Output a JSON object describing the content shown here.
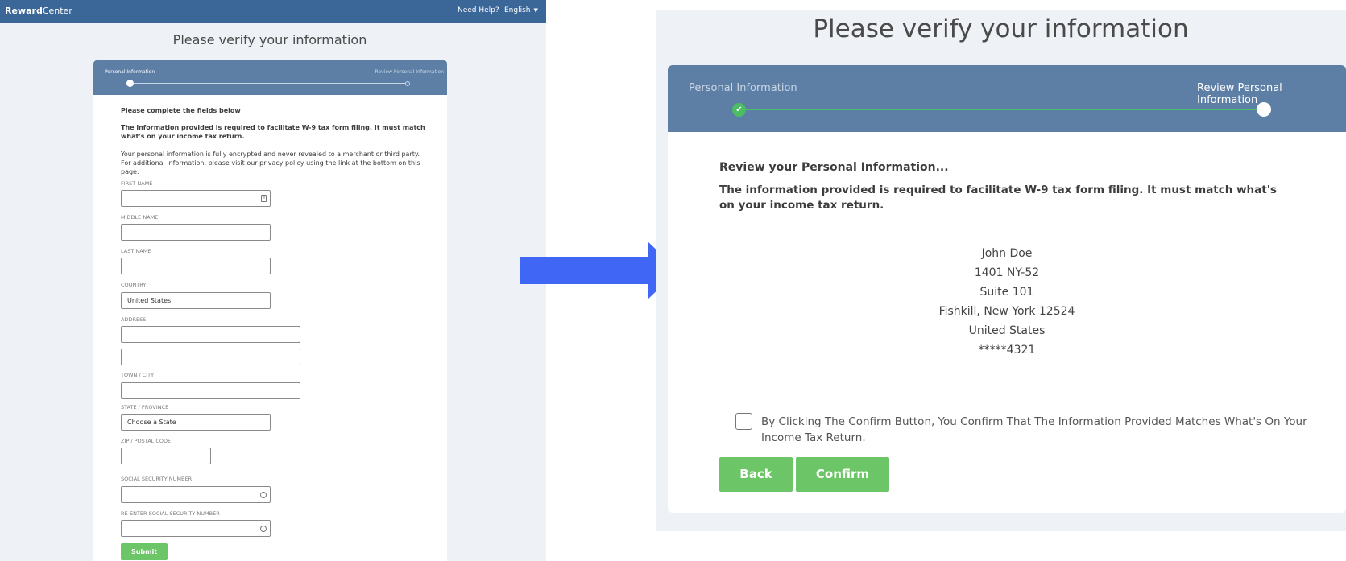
{
  "left": {
    "topbar": {
      "brand_bold": "Reward",
      "brand_thin": "Center",
      "need_help": "Need Help?",
      "language": "English",
      "language_caret": "▼"
    },
    "title": "Please verify your information",
    "progress": {
      "step1": "Personal Information",
      "step2": "Review Personal Information"
    },
    "heading": "Please complete the fields below",
    "notice": "The information provided is required to facilitate W-9 tax form filing. It must match what's on your income tax return.",
    "privacy": "Your personal information is fully encrypted and never revealed to a merchant or third party. For additional information, please visit our privacy policy using the link at the bottom on this page.",
    "fields": {
      "first_name": "FIRST NAME",
      "middle_name": "MIDDLE NAME",
      "last_name": "LAST NAME",
      "country": "COUNTRY",
      "country_value": "United States",
      "address": "ADDRESS",
      "town": "TOWN / CITY",
      "state": "STATE / PROVINCE",
      "state_value": "Choose a State",
      "zip": "ZIP / POSTAL CODE",
      "ssn": "SOCIAL SECURITY NUMBER",
      "ssn_reenter": "RE-ENTER SOCIAL SECURITY NUMBER"
    },
    "submit": "Submit"
  },
  "right": {
    "title": "Please verify your information",
    "progress": {
      "step1": "Personal Information",
      "step2": "Review Personal Information",
      "check_glyph": "✔"
    },
    "subheading": "Review your Personal Information...",
    "notice": "The information provided is required to facilitate W-9 tax form filing. It must match what's on your income tax return.",
    "address": {
      "name": "John Doe",
      "line1": "1401 NY-52",
      "line2": "Suite 101",
      "city_state_zip": "Fishkill, New York 12524",
      "country": "United States",
      "ssn_masked": "*****4321"
    },
    "confirm_text": "By Clicking The Confirm Button, You Confirm That The Information Provided Matches What's On Your Income Tax Return.",
    "back": "Back",
    "confirm": "Confirm"
  },
  "colors": {
    "header": "#3a6698",
    "progress": "#5d7fa6",
    "green": "#6cc566",
    "arrow": "#3f66f5",
    "background": "#eef2f7"
  }
}
